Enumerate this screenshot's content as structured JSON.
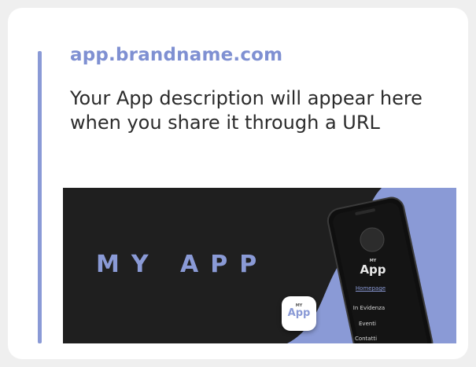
{
  "link_preview": {
    "domain": "app.brandname.com",
    "description": "Your App description will appear here when you share it through a URL",
    "image": {
      "title": "MY APP",
      "app_icon": {
        "small_text": "MY",
        "name": "App"
      },
      "phone": {
        "logo": {
          "small_text": "MY",
          "name": "App"
        },
        "menu": [
          "Homepage",
          "In Evidenza",
          "Eventi",
          "Contatti"
        ],
        "active_menu_item": "Homepage"
      }
    }
  },
  "colors": {
    "accent": "#8a9ad6",
    "domain_text": "#7f90d2",
    "preview_background": "#1f1f1f",
    "page_background": "#efefef",
    "card_background": "#ffffff"
  }
}
